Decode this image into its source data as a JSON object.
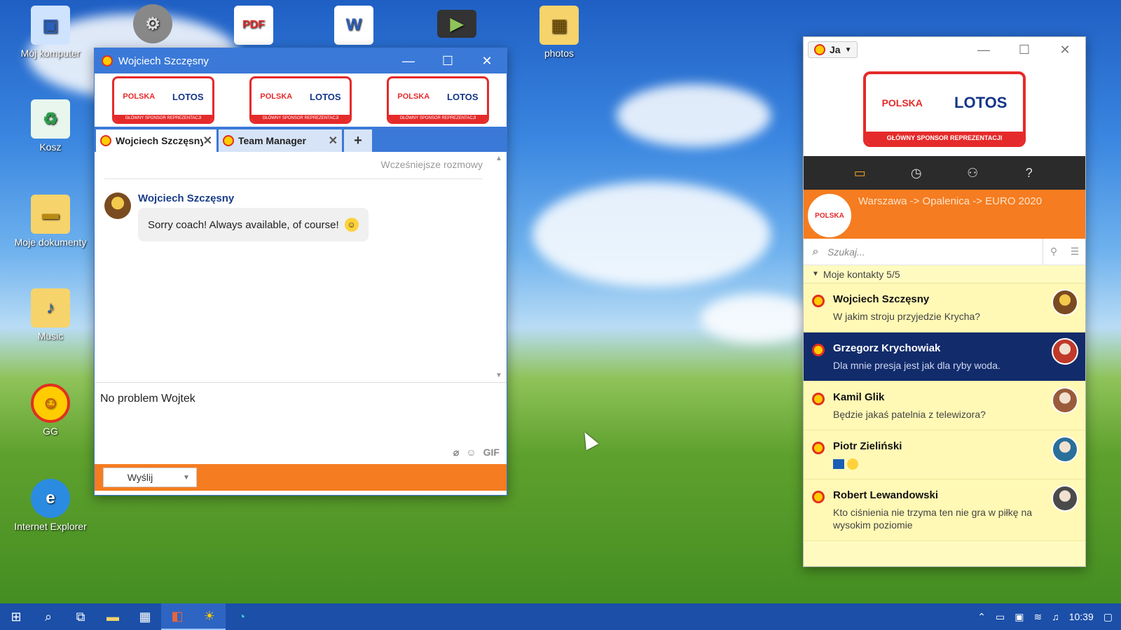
{
  "colors": {
    "accent_blue": "#3b79d8",
    "orange": "#f57c20",
    "selected_contact": "#122b6b",
    "contacts_bg": "#fff9b5"
  },
  "desktop": {
    "icons": [
      {
        "label": "Mój komputer",
        "icon": "computer-icon"
      },
      {
        "label": "Kosz",
        "icon": "recycle-bin-icon"
      },
      {
        "label": "Moje dokumenty",
        "icon": "folder-icon"
      },
      {
        "label": "Music",
        "icon": "music-folder-icon"
      },
      {
        "label": "GG",
        "icon": "gg-sun-icon"
      },
      {
        "label": "Internet Explorer",
        "icon": "ie-icon"
      },
      {
        "label": "",
        "icon": "gear-app-icon"
      },
      {
        "label": "",
        "icon": "pdf-icon",
        "glyph": "PDF"
      },
      {
        "label": "",
        "icon": "word-icon",
        "glyph": "W"
      },
      {
        "label": "",
        "icon": "video-icon"
      },
      {
        "label": "photos",
        "icon": "photos-folder-icon"
      }
    ]
  },
  "chat_window": {
    "title": "Wojciech Szczęsny",
    "banner": {
      "left": "POLSKA",
      "right": "LOTOS",
      "footer": "GŁÓWNY SPONSOR REPREZENTACJI"
    },
    "tabs": [
      {
        "label": "Wojciech Szczęsny"
      },
      {
        "label": "Team Manager"
      }
    ],
    "earlier_link": "Wcześniejsze rozmowy",
    "message": {
      "sender": "Wojciech Szczęsny",
      "text": "Sorry coach! Always available, of course!"
    },
    "compose_text": "No problem Wojtek",
    "gif_label": "GIF",
    "send_label": "Wyślij"
  },
  "contacts_window": {
    "user_label": "Ja",
    "banner": {
      "left": "POLSKA",
      "right": "LOTOS",
      "footer": "GŁÓWNY SPONSOR REPREZENTACJI"
    },
    "status_avatar_label": "POLSKA",
    "status_text": "Warszawa -> Opalenica -> EURO 2020",
    "search_placeholder": "Szukaj...",
    "group_label": "Moje kontakty 5/5",
    "contacts": [
      {
        "name": "Wojciech Szczęsny",
        "desc": "W jakim stroju przyjedzie Krycha?",
        "selected": false
      },
      {
        "name": "Grzegorz Krychowiak",
        "desc": "Dla mnie presja jest jak dla ryby woda.",
        "selected": true
      },
      {
        "name": "Kamil Glik",
        "desc": "Będzie jakaś patelnia z telewizora?",
        "selected": false
      },
      {
        "name": "Piotr Zieliński",
        "desc": "",
        "selected": false
      },
      {
        "name": "Robert Lewandowski",
        "desc": "Kto ciśnienia nie trzyma ten nie gra w piłkę na wysokim poziomie",
        "selected": false
      }
    ]
  },
  "taskbar": {
    "clock": "10:39"
  }
}
